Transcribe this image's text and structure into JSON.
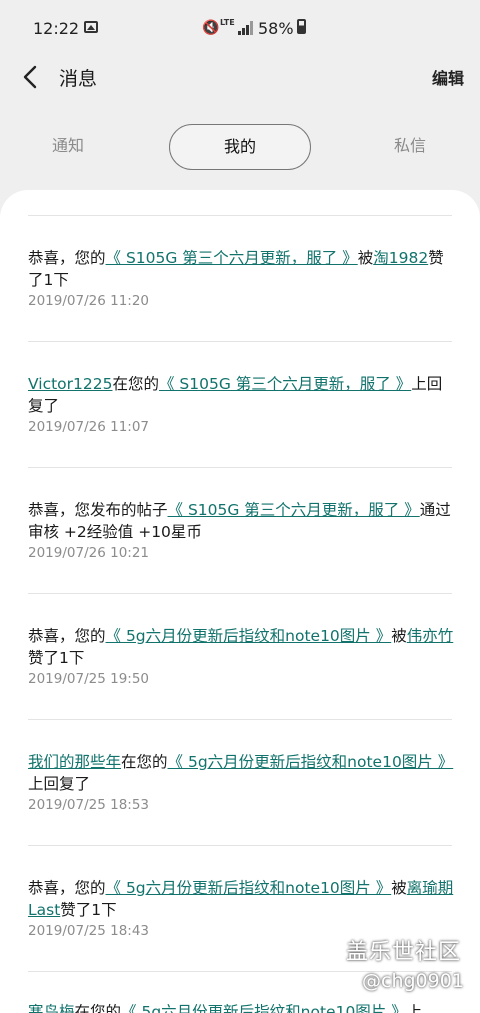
{
  "status_bar": {
    "time": "12:22",
    "lte": "LTE",
    "battery": "58%"
  },
  "header": {
    "title": "消息",
    "edit_label": "编辑"
  },
  "tabs": [
    {
      "label": "通知",
      "selected": false
    },
    {
      "label": "我的",
      "selected": true
    },
    {
      "label": "私信",
      "selected": false
    }
  ],
  "messages": [
    {
      "pre": "恭喜，您的",
      "link1": "《 S105G 第三个六月更新，服了 》",
      "mid": "被",
      "link2": "淘1982",
      "post": "赞了1下",
      "time": "2019/07/26 11:20"
    },
    {
      "link1": "Victor1225",
      "mid": "在您的",
      "link2": "《 S105G 第三个六月更新，服了 》",
      "post": "上回复了",
      "time": "2019/07/26 11:07"
    },
    {
      "pre": "恭喜，您发布的帖子",
      "link1": "《 S105G 第三个六月更新，服了 》",
      "post": "通过审核 +2经验值 +10星币",
      "time": "2019/07/26 10:21"
    },
    {
      "pre": "恭喜，您的",
      "link1": "《 5g六月份更新后指纹和note10图片 》",
      "mid": "被",
      "link2": "伟亦竹",
      "post": "赞了1下",
      "time": "2019/07/25 19:50"
    },
    {
      "link1": "我们的那些年",
      "mid": "在您的",
      "link2": "《 5g六月份更新后指纹和note10图片 》",
      "post": "上回复了",
      "time": "2019/07/25 18:53"
    },
    {
      "pre": "恭喜，您的",
      "link1": "《 5g六月份更新后指纹和note10图片 》",
      "mid": "被",
      "link2": "离瑜期Last",
      "post": "赞了1下",
      "time": "2019/07/25 18:43"
    },
    {
      "link1": "寒鸟梅",
      "mid": "在您的",
      "link2": "《 5g六月份更新后指纹和note10图片 》",
      "post": "上",
      "time": ""
    }
  ],
  "watermark": {
    "line1": "盖乐世社区",
    "line2": "@chg0901"
  }
}
